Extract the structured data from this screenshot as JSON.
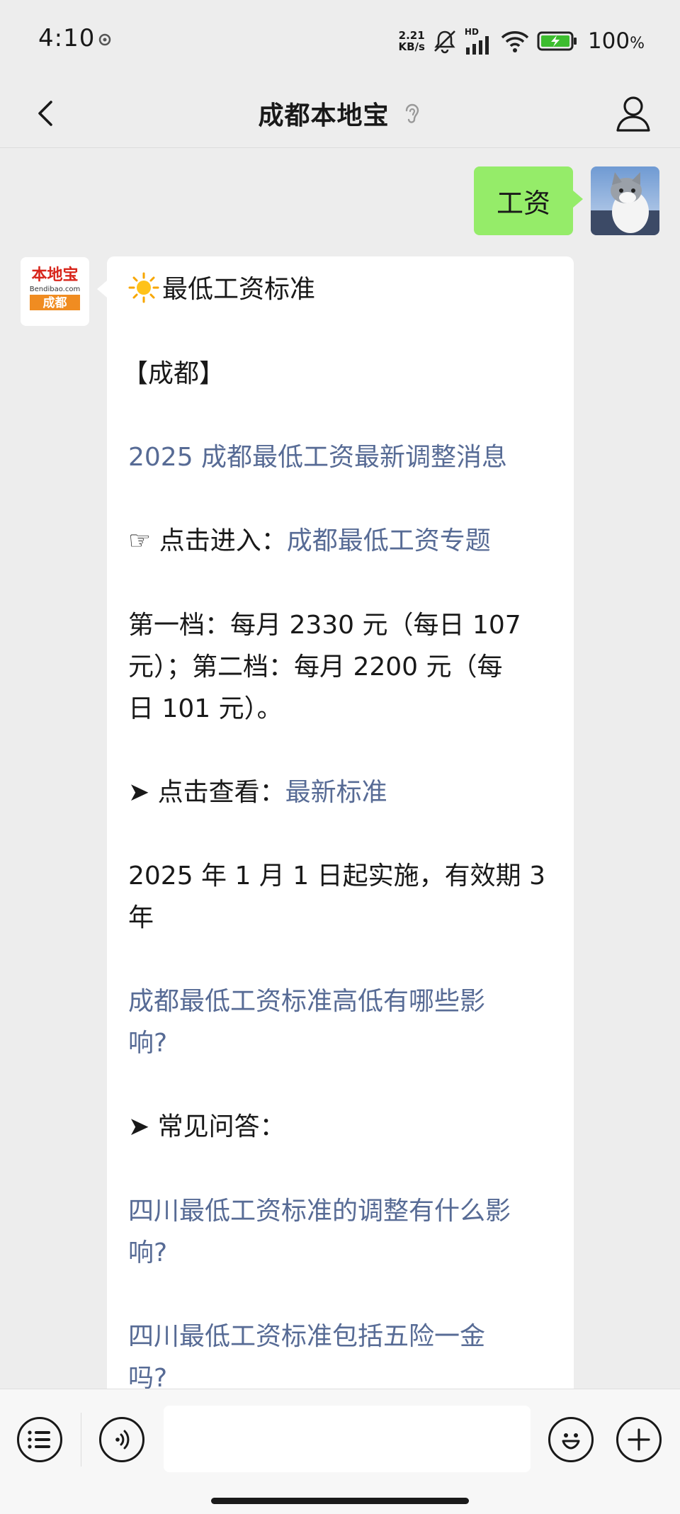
{
  "status_bar": {
    "time": "4:10",
    "net_speed_value": "2.21",
    "net_speed_unit": "KB/s",
    "network_label": "HD",
    "battery_percent": "100",
    "battery_percent_sign": "%"
  },
  "nav": {
    "title": "成都本地宝"
  },
  "chat": {
    "user_message": "工资",
    "bot_avatar": {
      "brand_top": "本地宝",
      "brand_site": "Bendibao.com",
      "brand_city": "成都"
    },
    "bot_lines": [
      {
        "text": "最低工资标准"
      },
      {
        "text": "【成都】"
      },
      {
        "text": "2025 成都最低工资最新调整消息"
      },
      {
        "prefix": "☞ 点击进入：",
        "link": "成都最低工资专题"
      },
      {
        "text": "第一档：每月 2330 元（每日 107"
      },
      {
        "text": "元）；第二档：每月 2200 元（每"
      },
      {
        "text": "日 101 元）。"
      },
      {
        "prefix": "➤ 点击查看：",
        "link": "最新标准"
      },
      {
        "text": "2025 年 1 月 1 日起实施，有效期 3"
      },
      {
        "text": "年"
      },
      {
        "text": "成都最低工资标准高低有哪些影"
      },
      {
        "text": "响?"
      },
      {
        "text": "➤ 常见问答："
      },
      {
        "text": "四川最低工资标准的调整有什么影"
      },
      {
        "text": "响?"
      },
      {
        "text": "四川最低工资标准包括五险一金"
      },
      {
        "text": "吗?"
      }
    ]
  },
  "input_bar": {
    "placeholder": ""
  },
  "colors": {
    "background": "#ededed",
    "user_bubble": "#95ec69",
    "link": "#576b95",
    "bot_bubble": "#ffffff"
  }
}
